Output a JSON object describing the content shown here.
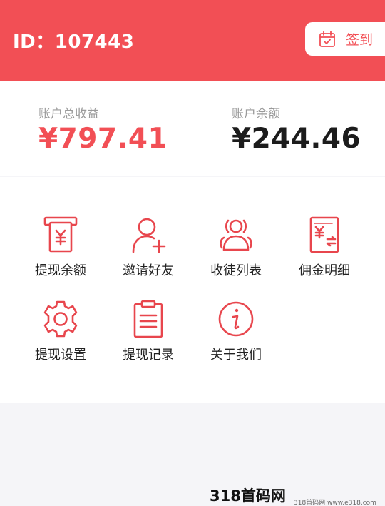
{
  "header": {
    "user_id": "ID：107443",
    "signin_label": "签到"
  },
  "balance": {
    "total_label": "账户总收益",
    "total_value": "¥797.41",
    "balance_label": "账户余额",
    "balance_value": "¥244.46"
  },
  "menu": {
    "items": [
      {
        "label": "提现余额",
        "icon": "withdraw-icon"
      },
      {
        "label": "邀请好友",
        "icon": "add-user-icon"
      },
      {
        "label": "收徒列表",
        "icon": "group-icon"
      },
      {
        "label": "佣金明细",
        "icon": "commission-icon"
      },
      {
        "label": "提现设置",
        "icon": "gear-icon"
      },
      {
        "label": "提现记录",
        "icon": "clipboard-icon"
      },
      {
        "label": "关于我们",
        "icon": "info-icon"
      }
    ]
  },
  "watermark": {
    "text": "318首码网 www.e318.com",
    "small": "318首码网 www.e318.com"
  },
  "colors": {
    "accent": "#f24f55",
    "text": "#1c1c1c",
    "muted": "#9a9a9a",
    "page_bg": "#f5f5f8"
  }
}
